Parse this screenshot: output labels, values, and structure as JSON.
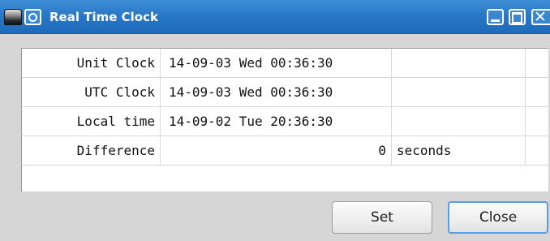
{
  "window": {
    "title": "Real Time Clock",
    "close_glyph": "✕"
  },
  "table": {
    "rows": [
      {
        "label": "Unit Clock",
        "value": "14-09-03 Wed 00:36:30",
        "unit": ""
      },
      {
        "label": "UTC Clock",
        "value": "14-09-03 Wed 00:36:30",
        "unit": ""
      },
      {
        "label": "Local time",
        "value": "14-09-02 Tue 20:36:30",
        "unit": ""
      },
      {
        "label": "Difference",
        "value": "0",
        "unit": "seconds"
      }
    ]
  },
  "buttons": {
    "set_label": "Set",
    "close_label": "Close"
  },
  "colors": {
    "titlebar": "#2878c8",
    "focus_ring": "#5a9ee0"
  }
}
